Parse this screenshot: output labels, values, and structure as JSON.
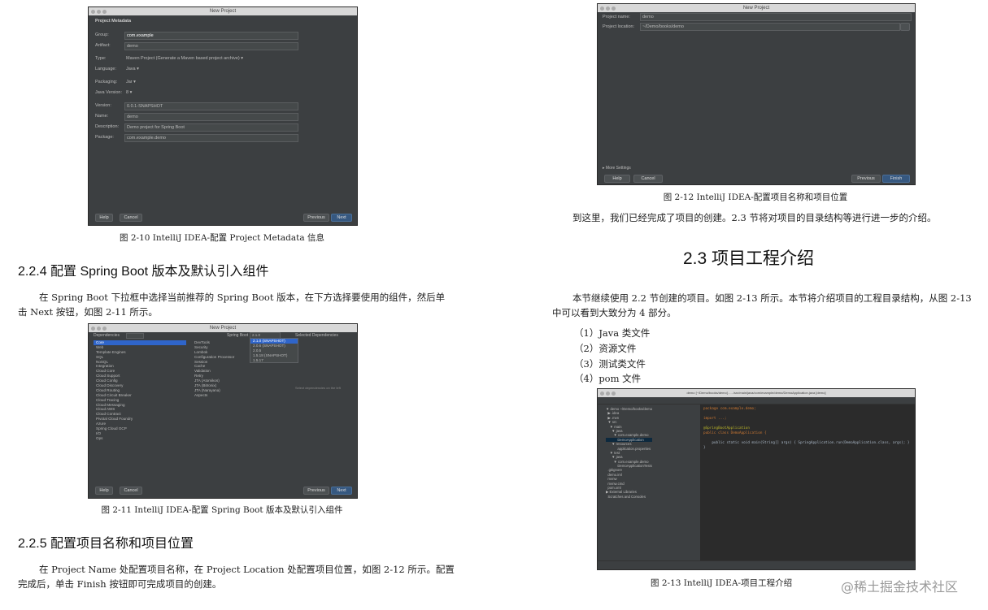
{
  "fig10": {
    "title": "New Project",
    "section": "Project Metadata",
    "fields": [
      {
        "label": "Group:",
        "value": "com.example"
      },
      {
        "label": "Artifact:",
        "value": "demo"
      },
      {
        "label": "Type:",
        "value": "Maven Project (Generate a Maven based project archive)"
      },
      {
        "label": "Language:",
        "value": "Java"
      },
      {
        "label": "Packaging:",
        "value": "Jar"
      },
      {
        "label": "Java Version:",
        "value": "8"
      },
      {
        "label": "Version:",
        "value": "0.0.1-SNAPSHOT"
      },
      {
        "label": "Name:",
        "value": "demo"
      },
      {
        "label": "Description:",
        "value": "Demo project for Spring Boot"
      },
      {
        "label": "Package:",
        "value": "com.example.demo"
      }
    ],
    "buttons": {
      "help": "Help",
      "cancel": "Cancel",
      "previous": "Previous",
      "next": "Next"
    },
    "caption": "图 2-10    IntelliJ IDEA-配置 Project Metadata 信息"
  },
  "sec224": {
    "heading": "2.2.4    配置 Spring Boot 版本及默认引入组件",
    "para1": "在 Spring Boot 下拉框中选择当前推荐的 Spring Boot 版本，在下方选择要使用的组件，然后单",
    "para2": "击 Next 按钮，如图 2-11 所示。"
  },
  "fig11": {
    "title": "New Project",
    "dependencies_label": "Dependencies",
    "spring_boot_label": "Spring Boot",
    "spring_boot_value": "2.1.0",
    "selected_label": "Selected Dependencies",
    "versions": [
      "2.1.0 (SNAPSHOT)",
      "2.0.6 (SNAPSHOT)",
      "2.0.5",
      "1.5.18 (SNAPSHOT)",
      "1.5.17"
    ],
    "categories": [
      "Core",
      "Web",
      "Template Engines",
      "SQL",
      "NoSQL",
      "Integration",
      "Cloud Core",
      "Cloud Support",
      "Cloud Config",
      "Cloud Discovery",
      "Cloud Routing",
      "Cloud Circuit Breaker",
      "Cloud Tracing",
      "Cloud Messaging",
      "Cloud AWS",
      "Cloud Contract",
      "Pivotal Cloud Foundry",
      "Azure",
      "Spring Cloud GCP",
      "I/O",
      "Ops"
    ],
    "components": [
      "DevTools",
      "Security",
      "Lombok",
      "Configuration Processor",
      "Session",
      "Cache",
      "Validation",
      "Retry",
      "JTA (Atomikos)",
      "JTA (Bitronix)",
      "JTA (Narayana)",
      "Aspects"
    ],
    "no_deps": "Select dependencies on the left",
    "buttons": {
      "help": "Help",
      "cancel": "Cancel",
      "previous": "Previous",
      "next": "Next"
    },
    "caption": "图 2-11    IntelliJ IDEA-配置 Spring Boot 版本及默认引入组件"
  },
  "sec225": {
    "heading": "2.2.5    配置项目名称和项目位置",
    "para1": "在 Project Name 处配置项目名称，在 Project Location 处配置项目位置，如图 2-12 所示。配置",
    "para2": "完成后，单击 Finish 按钮即可完成项目的创建。"
  },
  "fig12": {
    "title": "New Project",
    "name_label": "Project name:",
    "name_value": "demo",
    "location_label": "Project location:",
    "location_value": "~/Demo/books/demo",
    "more_settings": "▸ More Settings",
    "buttons": {
      "help": "Help",
      "cancel": "Cancel",
      "previous": "Previous",
      "finish": "Finish"
    },
    "caption": "图 2-12    IntelliJ IDEA-配置项目名称和项目位置"
  },
  "right_text": {
    "para_done": "到这里，我们已经完成了项目的创建。2.3 节将对项目的目录结构等进行进一步的介绍。",
    "heading23": "2.3    项目工程介绍",
    "para1": "本节继续使用 2.2 节创建的项目。如图 2-13 所示。本节将介绍项目的工程目录结构，从图 2-13",
    "para2": "中可以看到大致分为 4 部分。",
    "list": [
      "（1）Java 类文件",
      "（2）资源文件",
      "（3）测试类文件",
      "（4）pom 文件"
    ]
  },
  "fig13": {
    "title": "demo [~/Demo/books/demo] - .../src/main/java/com/example/demo/DemoApplication.java [demo]",
    "tree": [
      "▼ demo ~/Demo/books/demo",
      "  ▶ .idea",
      "  ▶ .mvn",
      "  ▼ src",
      "    ▼ main",
      "      ▼ java",
      "        ▼ com.example.demo",
      "            DemoApplication",
      "      ▼ resources",
      "            application.properties",
      "    ▼ test",
      "      ▼ java",
      "        ▼ com.example.demo",
      "            DemoApplicationTests",
      "  .gitignore",
      "  demo.iml",
      "  mvnw",
      "  mvnw.cmd",
      "  pom.xml",
      "▶ External Libraries",
      "  Scratches and Consoles"
    ],
    "code": [
      "package com.example.demo;",
      "",
      "import ...;",
      "",
      "@SpringBootApplication",
      "public class DemoApplication {",
      "",
      "    public static void main(String[] args) { SpringApplication.run(DemoApplication.class, args); }",
      "}"
    ],
    "caption": "图 2-13    IntelliJ IDEA-项目工程介绍"
  },
  "watermark": "@稀土掘金技术社区"
}
